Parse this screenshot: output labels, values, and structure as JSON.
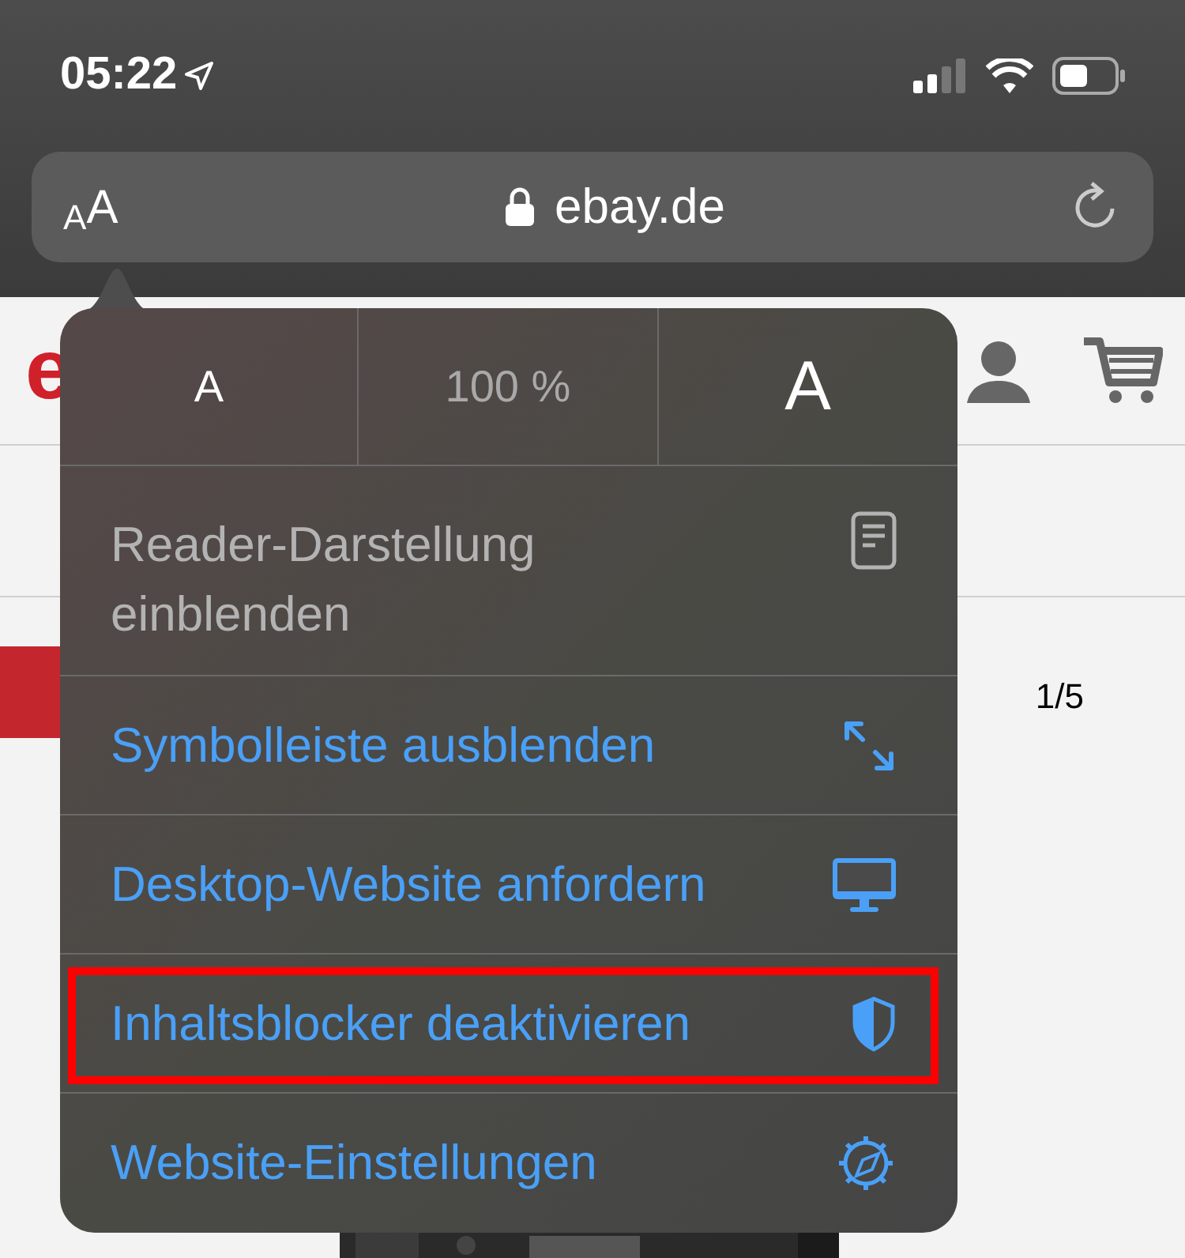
{
  "status_bar": {
    "time": "05:22"
  },
  "address_bar": {
    "text_size_small": "A",
    "text_size_large": "A",
    "url": "ebay.de"
  },
  "page": {
    "logo": "e",
    "counter": "1/5"
  },
  "menu": {
    "zoom": {
      "decrease": "A",
      "level": "100 %",
      "increase": "A"
    },
    "items": [
      {
        "label": "Reader-Darstellung einblenden",
        "kind": "reader",
        "disabled": true,
        "highlighted": false
      },
      {
        "label": "Symbolleiste ausblenden",
        "kind": "expand",
        "disabled": false,
        "highlighted": false
      },
      {
        "label": "Desktop-Website anfordern",
        "kind": "desktop",
        "disabled": false,
        "highlighted": false
      },
      {
        "label": "Inhaltsblocker deaktivieren",
        "kind": "shield",
        "disabled": false,
        "highlighted": true
      },
      {
        "label": "Website-Einstellungen",
        "kind": "gear",
        "disabled": false,
        "highlighted": false
      }
    ]
  }
}
